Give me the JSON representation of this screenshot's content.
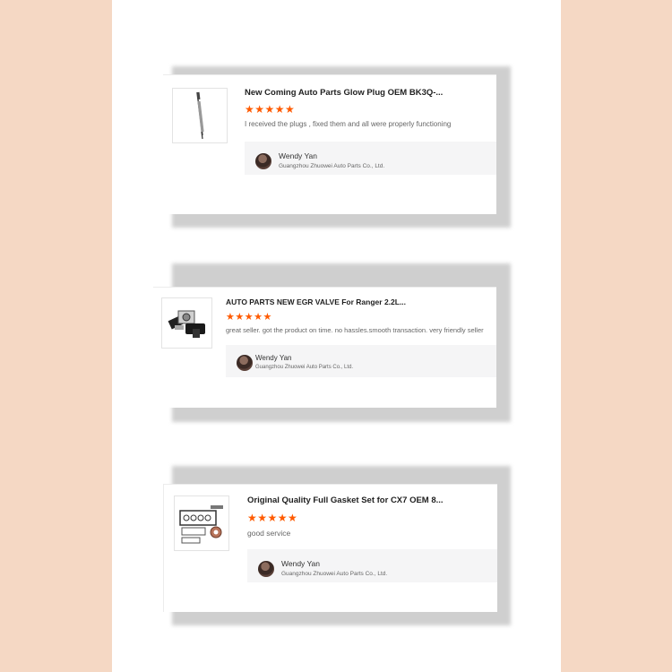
{
  "colors": {
    "background": "#f5d8c4",
    "panel": "#ffffff",
    "star": "#ff5a00",
    "shadow": "#cfcfcf"
  },
  "reviews": [
    {
      "product_image": "glow-plug-image",
      "title": "New Coming Auto Parts Glow Plug OEM BK3Q-...",
      "stars": "★★★★★",
      "rating": 5,
      "text": "I received the plugs , fixed them and all were properly functioning",
      "reviewer": {
        "name": "Wendy Yan",
        "company": "Guangzhou Zhuowei Auto Parts Co., Ltd."
      }
    },
    {
      "product_image": "egr-valve-image",
      "title": "AUTO PARTS NEW EGR VALVE For Ranger 2.2L...",
      "stars": "★★★★★",
      "rating": 5,
      "text": "great seller. got the product on time. no hassles.smooth transaction. very friendly seller",
      "reviewer": {
        "name": "Wendy Yan",
        "company": "Guangzhou Zhuowei Auto Parts Co., Ltd."
      }
    },
    {
      "product_image": "gasket-set-image",
      "title": "Original Quality Full Gasket Set for CX7 OEM 8...",
      "stars": "★★★★★",
      "rating": 5,
      "text": "good service",
      "reviewer": {
        "name": "Wendy Yan",
        "company": "Guangzhou Zhuowei Auto Parts Co., Ltd."
      }
    }
  ]
}
